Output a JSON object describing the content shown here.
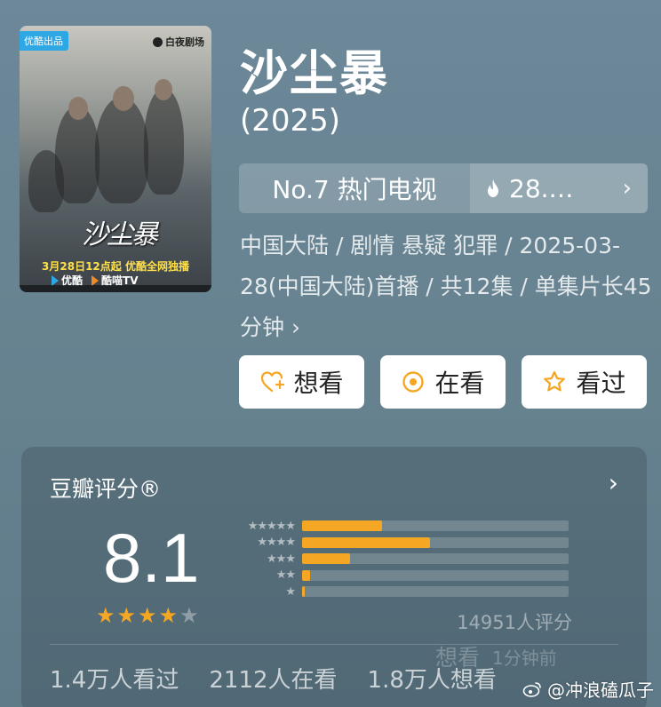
{
  "poster": {
    "badge_left": "优酷出品",
    "badge_right": "白夜剧场",
    "logo_text": "沙尘暴",
    "date_line": "3月28日12点起  优酷全网独播",
    "platform_1": "优酷",
    "platform_2": "酷喵TV"
  },
  "header": {
    "title": "沙尘暴",
    "year": "(2025)"
  },
  "rank": {
    "label": "No.7 热门电视",
    "heat": "28.…"
  },
  "meta": {
    "text": "中国大陆 / 剧情 悬疑 犯罪 / 2025-03-28(中国大陆)首播 / 共12集 / 单集片长45分钟 ›"
  },
  "actions": {
    "want": "想看",
    "watching": "在看",
    "watched": "看过"
  },
  "rating": {
    "title": "豆瓣评分®",
    "score": "8.1",
    "stars_filled": 4,
    "count": "14951人评分",
    "distribution": [
      {
        "stars": "★★★★★",
        "fraction": 0.3
      },
      {
        "stars": "★★★★",
        "fraction": 0.48
      },
      {
        "stars": "★★★",
        "fraction": 0.18
      },
      {
        "stars": "★★",
        "fraction": 0.03
      },
      {
        "stars": "★",
        "fraction": 0.01
      }
    ],
    "stats": {
      "watched": "1.4万人看过",
      "watching": "2112人在看",
      "want": "1.8万人想看"
    },
    "ghost_overlay": "想看",
    "ghost_time": "1分钟前"
  },
  "watermark": {
    "text": "@冲浪磕瓜子"
  },
  "colors": {
    "accent_orange": "#f5a623",
    "background": "#6a8697"
  }
}
